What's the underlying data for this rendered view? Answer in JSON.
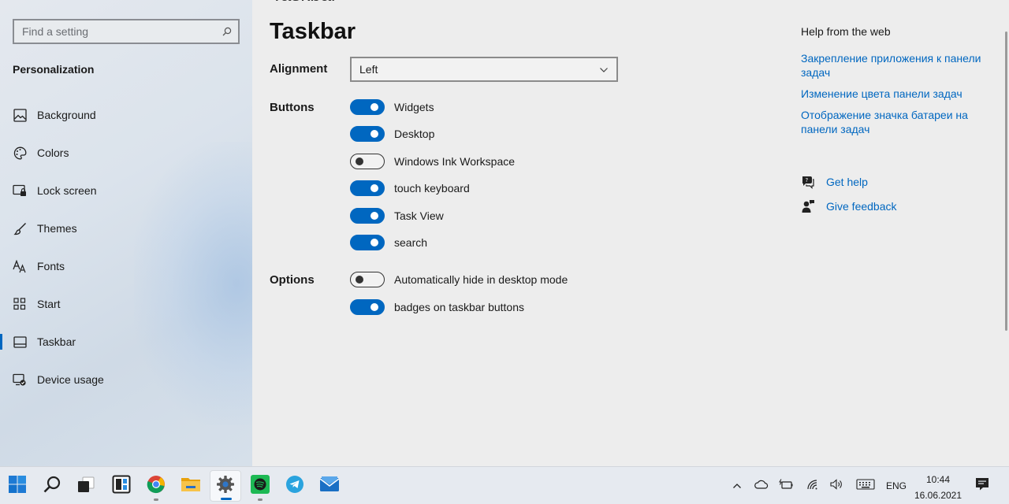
{
  "sidebar": {
    "search_placeholder": "Find a setting",
    "section_title": "Personalization",
    "items": [
      {
        "label": "Background",
        "icon": "picture-icon"
      },
      {
        "label": "Colors",
        "icon": "palette-icon"
      },
      {
        "label": "Lock screen",
        "icon": "lock-screen-icon"
      },
      {
        "label": "Themes",
        "icon": "brush-icon"
      },
      {
        "label": "Fonts",
        "icon": "font-icon"
      },
      {
        "label": "Start",
        "icon": "start-grid-icon"
      },
      {
        "label": "Taskbar",
        "icon": "taskbar-icon",
        "active": true
      },
      {
        "label": "Device usage",
        "icon": "device-usage-icon"
      }
    ]
  },
  "main": {
    "cut_title": "Taskbar",
    "title": "Taskbar",
    "alignment_label": "Alignment",
    "alignment_value": "Left",
    "buttons_label": "Buttons",
    "buttons": [
      {
        "label": "Widgets",
        "on": true
      },
      {
        "label": "Desktop",
        "on": true
      },
      {
        "label": "Windows Ink Workspace",
        "on": false
      },
      {
        "label": "touch keyboard",
        "on": true
      },
      {
        "label": "Task View",
        "on": true
      },
      {
        "label": "search",
        "on": true
      }
    ],
    "options_label": "Options",
    "options": [
      {
        "label": "Automatically hide in desktop mode",
        "on": false
      },
      {
        "label": "badges on taskbar buttons",
        "on": true
      }
    ]
  },
  "help": {
    "title": "Help from the web",
    "links": [
      "Закрепление приложения к панели задач",
      "Изменение цвета панели задач",
      "Отображение значка батареи на панели задач"
    ],
    "get_help": "Get help",
    "give_feedback": "Give feedback"
  },
  "taskbar": {
    "apps": [
      "start-icon",
      "search-icon",
      "task-view-icon",
      "widgets-icon",
      "chrome-icon",
      "file-explorer-icon",
      "settings-icon",
      "spotify-icon",
      "telegram-icon",
      "mail-icon"
    ],
    "active_app": "settings-icon",
    "language": "ENG",
    "time": "10:44",
    "date": "16.06.2021"
  },
  "colors": {
    "accent": "#0067c0",
    "sidebar_bg": "#dbe3ec",
    "main_bg": "#ededed"
  }
}
